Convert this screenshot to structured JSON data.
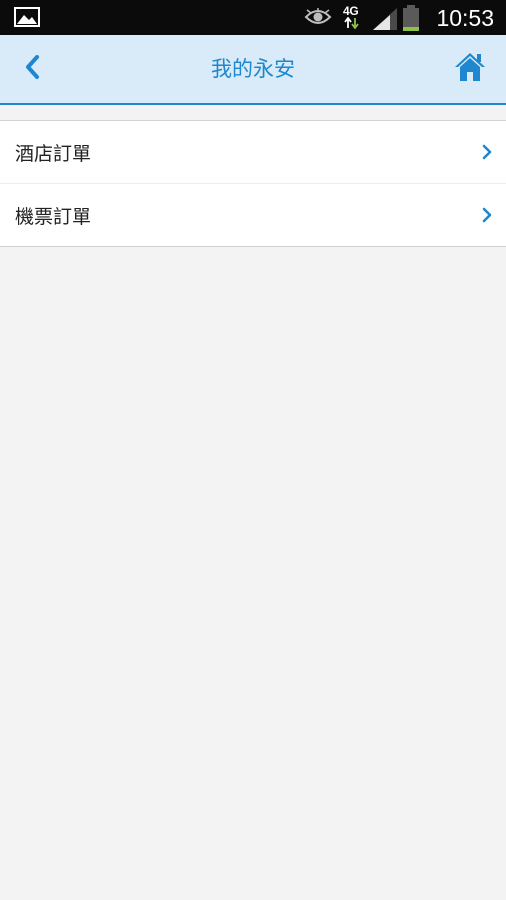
{
  "status_bar": {
    "time": "10:53",
    "network_type": "4G",
    "icons": [
      "gallery-icon",
      "eye-icon",
      "network-4g-icon",
      "signal-icon",
      "battery-icon"
    ]
  },
  "header": {
    "title": "我的永安",
    "back_icon": "chevron-left-icon",
    "home_icon": "home-icon"
  },
  "menu": {
    "items": [
      {
        "label": "酒店訂單",
        "icon": "chevron-right-icon"
      },
      {
        "label": "機票訂單",
        "icon": "chevron-right-icon"
      }
    ]
  },
  "colors": {
    "accent": "#1f87cf",
    "header_background": "#d9ebf8",
    "page_background": "#f3f3f3",
    "status_bar_background": "#0b0b0b"
  }
}
